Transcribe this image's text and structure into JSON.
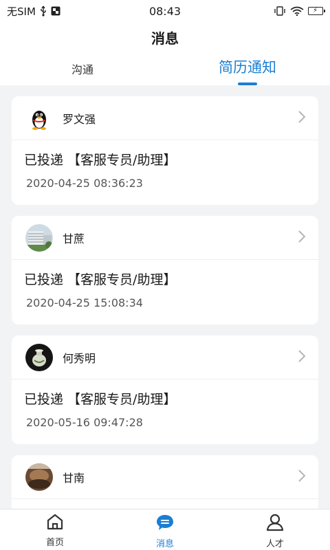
{
  "status_bar": {
    "carrier": "无SIM",
    "time": "08:43"
  },
  "header": {
    "title": "消息"
  },
  "tabs": [
    {
      "label": "沟通",
      "active": false
    },
    {
      "label": "简历通知",
      "active": true
    }
  ],
  "cards": [
    {
      "sender": "罗文强",
      "avatar_icon": "qq-penguin-avatar",
      "message": "已投递 【客服专员/助理】",
      "time": "2020-04-25 08:36:23"
    },
    {
      "sender": "甘蔗",
      "avatar_icon": "building-photo-avatar",
      "message": "已投递 【客服专员/助理】",
      "time": "2020-04-25 15:08:34"
    },
    {
      "sender": "何秀明",
      "avatar_icon": "vase-photo-avatar",
      "message": "已投递 【客服专员/助理】",
      "time": "2020-05-16 09:47:28"
    },
    {
      "sender": "甘南",
      "avatar_icon": "brown-photo-avatar",
      "message": "",
      "time": ""
    }
  ],
  "tabbar": [
    {
      "label": "首页",
      "icon": "home-icon",
      "active": false
    },
    {
      "label": "消息",
      "icon": "chat-icon",
      "active": true
    },
    {
      "label": "人才",
      "icon": "person-icon",
      "active": false
    }
  ],
  "colors": {
    "accent": "#1a7fd4",
    "background": "#f2f3f5"
  }
}
